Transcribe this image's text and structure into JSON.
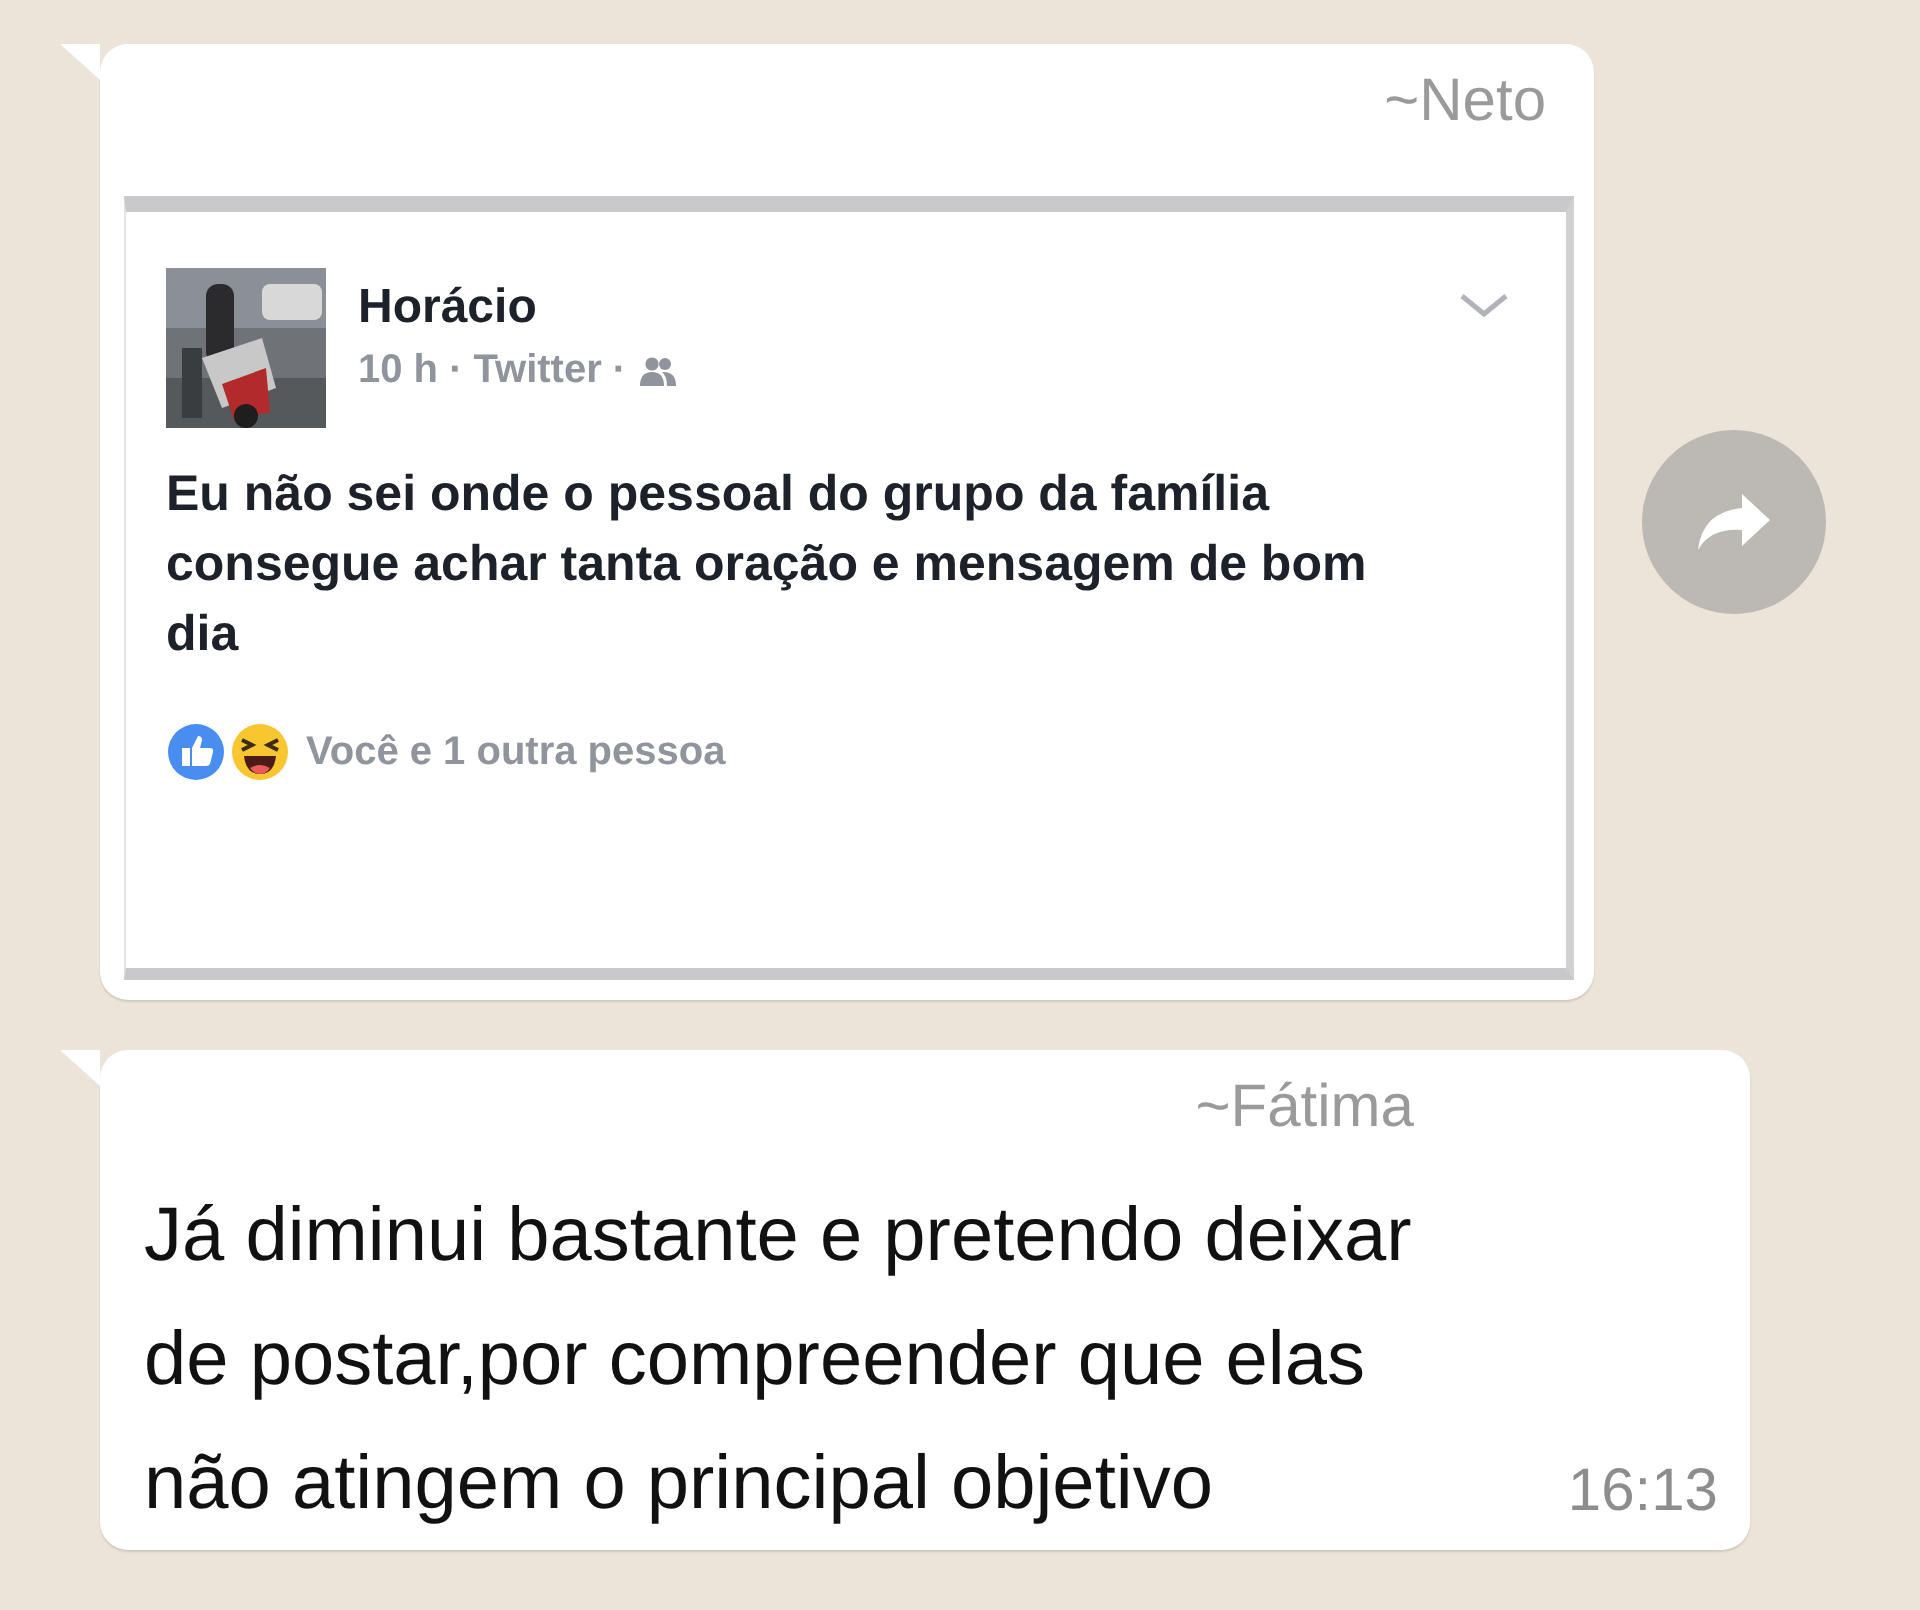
{
  "messages": [
    {
      "sender": "~Neto",
      "post": {
        "author": "Horácio",
        "meta": "10 h · Twitter ·",
        "text": "Eu não sei onde o pessoal do grupo da família consegue achar tanta oração e mensagem de bom dia",
        "reactions": "Você e 1 outra pessoa"
      }
    },
    {
      "kind": "text",
      "sender": "~Fátima",
      "text": "Já diminui bastante e pretendo deixar de postar,por compreender que elas não atingem o principal objetivo",
      "time": "16:13"
    }
  ]
}
